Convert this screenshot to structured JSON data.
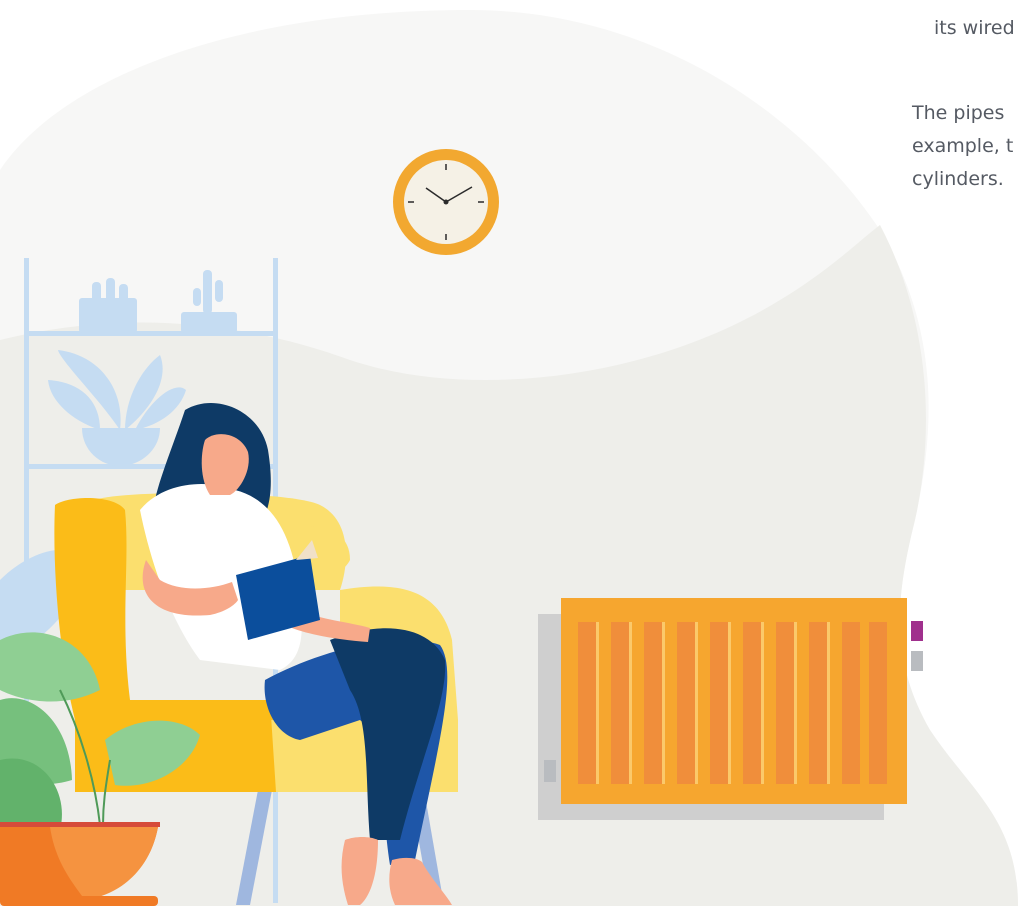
{
  "text_fragments": {
    "line_top": "its wired",
    "paragraph_lines": [
      "The pipes",
      "example, t",
      "cylinders."
    ]
  },
  "colors": {
    "background_blob": "#f7f7f6",
    "floor_blob": "#eeeeea",
    "clock_ring": "#f2a830",
    "clock_face": "#f5f1e6",
    "armchair": "#fbbc18",
    "armchair_light": "#fbdf6e",
    "radiator": "#f6a62f",
    "radiator_stripe": "#f08e3b",
    "woman_shirt": "#ffffff",
    "woman_hair": "#0e3a66",
    "woman_jeans": "#1e56a8",
    "book": "#0b4e9c",
    "shelf": "#c5dcf2",
    "pot": "#f07a25",
    "leaf": "#8fcf93",
    "swatch_purple": "#a0308d",
    "swatch_gray": "#b9bcc0"
  },
  "icons": [
    "wall-clock-icon",
    "cactus-icon",
    "plant-icon",
    "monstera-icon"
  ]
}
